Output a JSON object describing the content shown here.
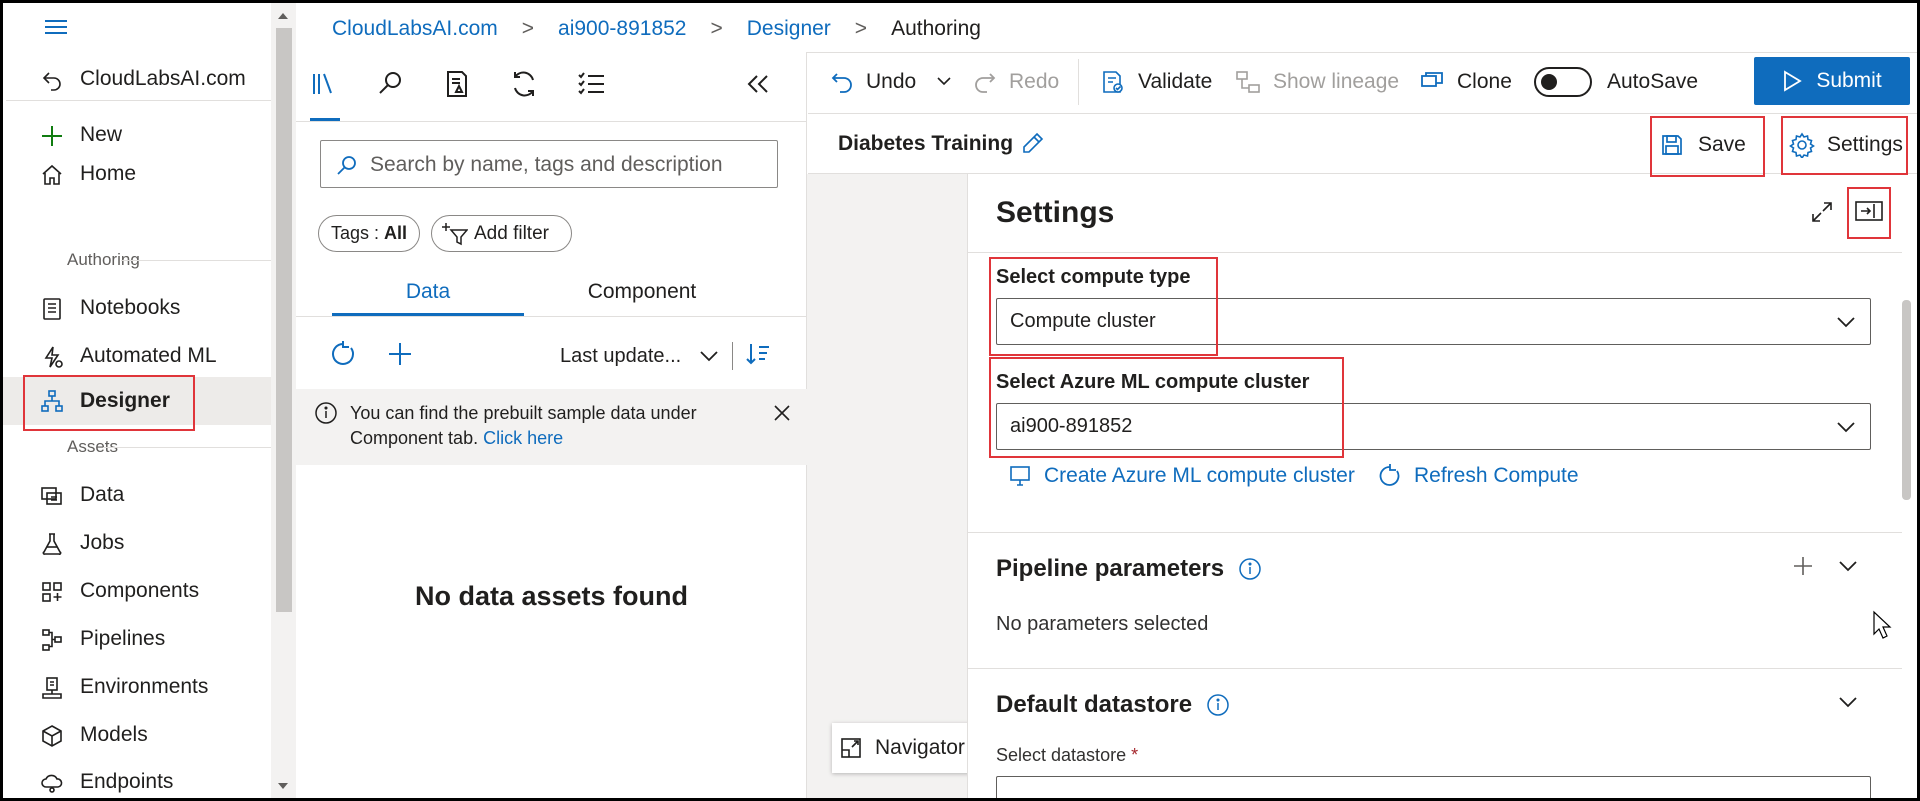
{
  "breadcrumb": {
    "items": [
      "CloudLabsAI.com",
      "ai900-891852",
      "Designer"
    ],
    "current": "Authoring"
  },
  "left_nav": {
    "workspace": "CloudLabsAI.com",
    "new": "New",
    "home": "Home",
    "section_authoring": "Authoring",
    "notebooks": "Notebooks",
    "automated_ml": "Automated ML",
    "designer": "Designer",
    "section_assets": "Assets",
    "data": "Data",
    "jobs": "Jobs",
    "components": "Components",
    "pipelines": "Pipelines",
    "environments": "Environments",
    "models": "Models",
    "endpoints": "Endpoints"
  },
  "library": {
    "search_placeholder": "Search by name, tags and description",
    "tags_label": "Tags : ",
    "tags_value": "All",
    "add_filter": "Add filter",
    "tabs": [
      "Data",
      "Component"
    ],
    "sort_label": "Last update...",
    "info_text": "You can find the prebuilt sample data under Component tab. ",
    "info_link": "Click here",
    "empty_text": "No data assets found"
  },
  "toolbar": {
    "undo": "Undo",
    "redo": "Redo",
    "validate": "Validate",
    "show_lineage": "Show lineage",
    "clone": "Clone",
    "autosave": "AutoSave",
    "submit": "Submit"
  },
  "pipeline": {
    "name": "Diabetes Training",
    "save": "Save",
    "settings": "Settings",
    "navigator": "Navigator"
  },
  "settings_panel": {
    "title": "Settings",
    "compute_type_label": "Select compute type",
    "compute_type_value": "Compute cluster",
    "cluster_label": "Select Azure ML compute cluster",
    "cluster_value": "ai900-891852",
    "create_cluster": "Create Azure ML compute cluster",
    "refresh_compute": "Refresh Compute",
    "pipeline_params_title": "Pipeline parameters",
    "no_params": "No parameters selected",
    "default_datastore_title": "Default datastore",
    "select_datastore_label": "Select datastore",
    "required_mark": "*"
  },
  "colors": {
    "accent": "#0f6cbd",
    "annotation": "#e0353a",
    "selected_bg": "#edebe9"
  }
}
